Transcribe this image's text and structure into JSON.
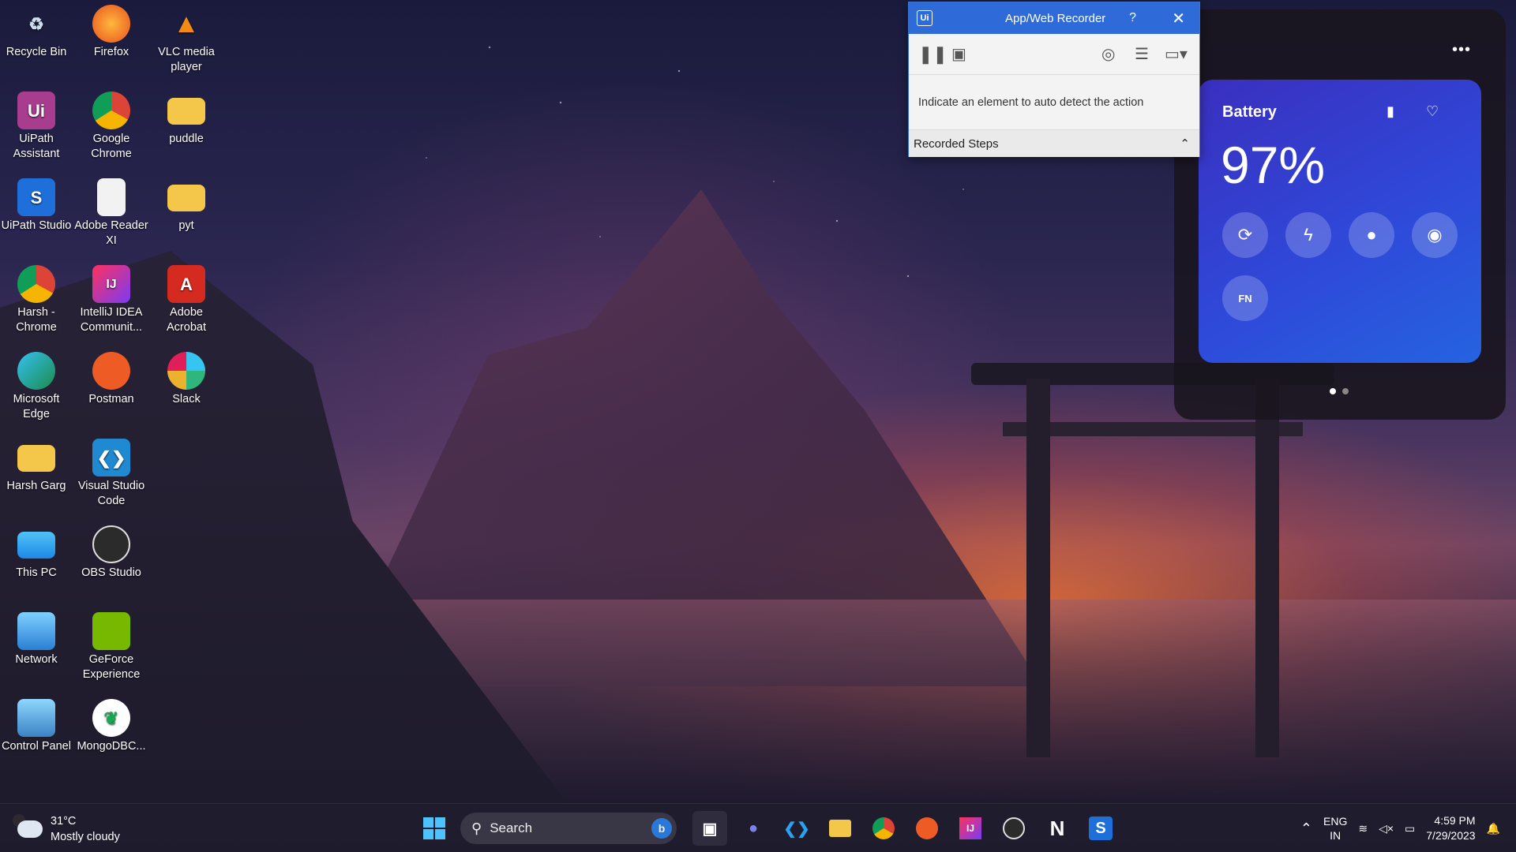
{
  "desktop": {
    "icons": [
      {
        "label": "Recycle Bin",
        "icon": "recycle-bin-icon"
      },
      {
        "label": "Firefox",
        "icon": "firefox-icon"
      },
      {
        "label": "VLC media player",
        "icon": "vlc-icon"
      },
      {
        "label": "UiPath Assistant",
        "icon": "uipath-assistant-icon"
      },
      {
        "label": "Google Chrome",
        "icon": "chrome-icon"
      },
      {
        "label": "puddle",
        "icon": "folder-icon"
      },
      {
        "label": "UiPath Studio",
        "icon": "uipath-studio-icon"
      },
      {
        "label": "Adobe Reader XI",
        "icon": "document-icon"
      },
      {
        "label": "pyt",
        "icon": "folder-icon"
      },
      {
        "label": "Harsh - Chrome",
        "icon": "chrome-profile-icon"
      },
      {
        "label": "IntelliJ IDEA Communit...",
        "icon": "intellij-icon"
      },
      {
        "label": "Adobe Acrobat",
        "icon": "acrobat-icon"
      },
      {
        "label": "Microsoft Edge",
        "icon": "edge-icon"
      },
      {
        "label": "Postman",
        "icon": "postman-icon"
      },
      {
        "label": "Slack",
        "icon": "slack-icon"
      },
      {
        "label": "Harsh Garg",
        "icon": "folder-icon"
      },
      {
        "label": "Visual Studio Code",
        "icon": "vscode-icon"
      },
      {
        "label": "This PC",
        "icon": "monitor-icon"
      },
      {
        "label": "OBS Studio",
        "icon": "obs-icon"
      },
      {
        "label": "Network",
        "icon": "network-icon"
      },
      {
        "label": "GeForce Experience",
        "icon": "nvidia-icon"
      },
      {
        "label": "Control Panel",
        "icon": "control-panel-icon"
      },
      {
        "label": "MongoDBC...",
        "icon": "mongodb-icon"
      }
    ]
  },
  "recorder": {
    "title": "App/Web Recorder",
    "logo_text": "Ui",
    "help": "?",
    "message": "Indicate an element to auto detect the action",
    "steps_label": "Recorded Steps",
    "accent": "#2f6bd8"
  },
  "battery": {
    "title": "Battery",
    "percent": "97%",
    "fn_label": "FN",
    "colors": {
      "from": "#3a2fbf",
      "to": "#2563e0"
    }
  },
  "taskbar": {
    "weather": {
      "temp": "31°C",
      "condition": "Mostly cloudy"
    },
    "search_label": "Search",
    "tray": {
      "lang": "ENG",
      "region": "IN",
      "time": "4:59 PM",
      "date": "7/29/2023"
    }
  }
}
